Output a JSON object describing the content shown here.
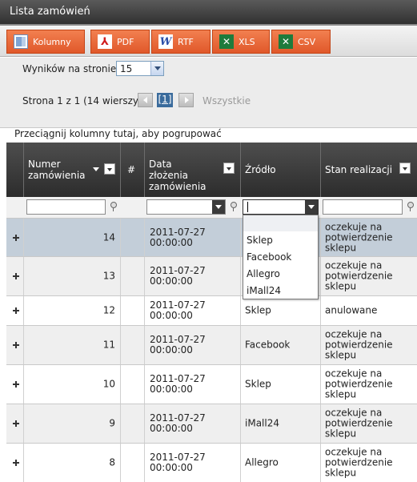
{
  "window": {
    "title": "Lista zamówień"
  },
  "export_toolbar": {
    "buttons": [
      {
        "label": "Kolumny",
        "icon": "columns-icon"
      },
      {
        "label": "PDF",
        "icon": "pdf-icon"
      },
      {
        "label": "RTF",
        "icon": "rtf-icon"
      },
      {
        "label": "XLS",
        "icon": "xls-icon"
      },
      {
        "label": "CSV",
        "icon": "csv-icon"
      }
    ]
  },
  "pagination": {
    "results_label": "Wyników na stronie:",
    "results_value": "15",
    "page_info": "Strona 1 z 1 (14 wierszy)",
    "current_page": "[1]",
    "all_label": "Wszystkie"
  },
  "grouping": {
    "hint": "Przeciągnij kolumny tutaj, aby pogrupować"
  },
  "columns": [
    {
      "label": "Numer zamówienia"
    },
    {
      "label": "#"
    },
    {
      "label": "Data złożenia zamówienia"
    },
    {
      "label": "Źródło"
    },
    {
      "label": "Stan realizacji"
    }
  ],
  "source_filter_options": [
    "",
    "Sklep",
    "Facebook",
    "Allegro",
    "iMall24"
  ],
  "rows": [
    {
      "number": "14",
      "date": "2011-07-27 00:00:00",
      "source": "",
      "status": "oczekuje na potwierdzenie sklepu"
    },
    {
      "number": "13",
      "date": "2011-07-27 00:00:00",
      "source": "",
      "status": "oczekuje na potwierdzenie sklepu"
    },
    {
      "number": "12",
      "date": "2011-07-27 00:00:00",
      "source": "Sklep",
      "status": "anulowane"
    },
    {
      "number": "11",
      "date": "2011-07-27 00:00:00",
      "source": "Facebook",
      "status": "oczekuje na potwierdzenie sklepu"
    },
    {
      "number": "10",
      "date": "2011-07-27 00:00:00",
      "source": "Sklep",
      "status": "oczekuje na potwierdzenie sklepu"
    },
    {
      "number": "9",
      "date": "2011-07-27 00:00:00",
      "source": "iMall24",
      "status": "oczekuje na potwierdzenie sklepu"
    },
    {
      "number": "8",
      "date": "2011-07-27 00:00:00",
      "source": "Allegro",
      "status": "oczekuje na potwierdzenie sklepu"
    }
  ]
}
